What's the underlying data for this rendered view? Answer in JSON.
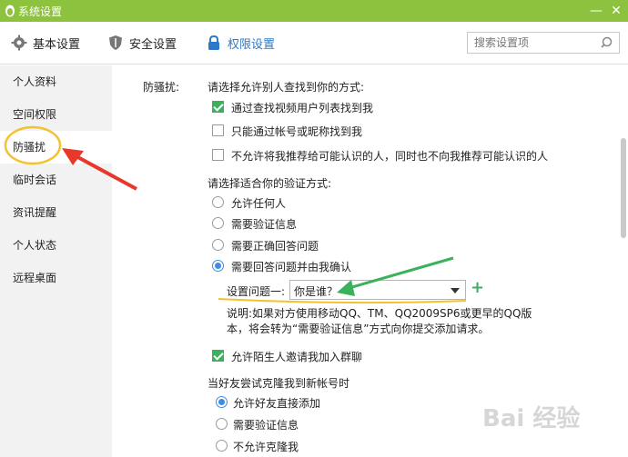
{
  "window": {
    "title": "系统设置"
  },
  "tabs": [
    {
      "label": "基本设置",
      "icon": "gear-icon"
    },
    {
      "label": "安全设置",
      "icon": "shield-icon"
    },
    {
      "label": "权限设置",
      "icon": "lock-icon"
    }
  ],
  "search": {
    "placeholder": "搜索设置项"
  },
  "sidebar": {
    "items": [
      {
        "label": "个人资料"
      },
      {
        "label": "空间权限"
      },
      {
        "label": "防骚扰"
      },
      {
        "label": "临时会话"
      },
      {
        "label": "资讯提醒"
      },
      {
        "label": "个人状态"
      },
      {
        "label": "远程桌面"
      }
    ]
  },
  "main": {
    "section_label": "防骚扰:",
    "find_heading": "请选择允许别人查找到你的方式:",
    "find_options": [
      {
        "label": "通过查找视频用户列表找到我",
        "checked": true
      },
      {
        "label": "只能通过帐号或昵称找到我",
        "checked": false
      },
      {
        "label": "不允许将我推荐给可能认识的人，同时也不向我推荐可能认识的人",
        "checked": false
      }
    ],
    "verify_heading": "请选择适合你的验证方式:",
    "verify_options": [
      {
        "label": "允许任何人",
        "checked": false
      },
      {
        "label": "需要验证信息",
        "checked": false
      },
      {
        "label": "需要正确回答问题",
        "checked": false
      },
      {
        "label": "需要回答问题并由我确认",
        "checked": true
      }
    ],
    "question_label": "设置问题一:",
    "question_value": "你是谁？",
    "note_line1": "说明:如果对方使用移动QQ、TM、QQ2009SP6或更早的QQ版",
    "note_line2": "本，将会转为“需要验证信息”方式向你提交添加请求。",
    "group_invite": {
      "label": "允许陌生人邀请我加入群聊",
      "checked": true
    },
    "clone_heading": "当好友尝试克隆我到新帐号时",
    "clone_options": [
      {
        "label": "允许好友直接添加",
        "checked": true
      },
      {
        "label": "需要验证信息",
        "checked": false
      },
      {
        "label": "不允许克隆我",
        "checked": false
      }
    ]
  },
  "watermark": "Bai 经验",
  "colors": {
    "titlebar": "#8dc23f",
    "accent": "#2e79c7",
    "check": "#3ab15a",
    "annotation_arrow": "#e8382c",
    "annotation_highlight": "#f2c230"
  }
}
